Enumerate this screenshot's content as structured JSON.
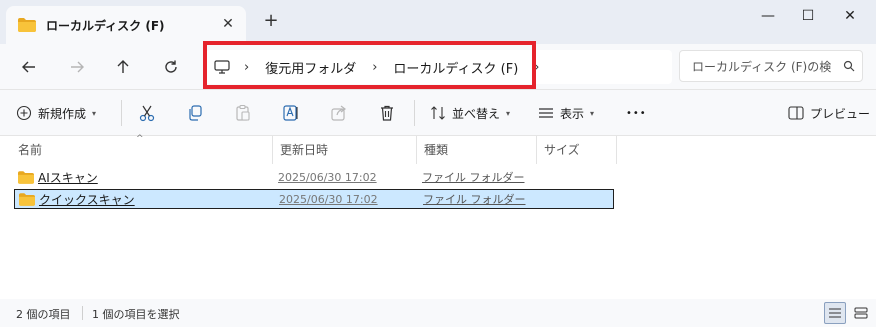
{
  "window": {
    "tab_title": "ローカルディスク (F)",
    "close_glyph": "✕",
    "new_tab_glyph": "+",
    "minimize_glyph": "—",
    "maximize_glyph": "☐",
    "close_window_glyph": "✕"
  },
  "breadcrumb": {
    "sep": "›",
    "items": [
      "復元用フォルダ",
      "ローカルディスク (F)"
    ]
  },
  "search": {
    "placeholder": "ローカルディスク (F)の検"
  },
  "toolbar": {
    "new_label": "新規作成",
    "sort_label": "並べ替え",
    "view_label": "表示",
    "more_glyph": "•••",
    "preview_label": "プレビュー",
    "caret": "▾"
  },
  "columns": [
    "名前",
    "更新日時",
    "種類",
    "サイズ"
  ],
  "sort_glyph": "^",
  "files": [
    {
      "name": "AIスキャン",
      "date": "2025/06/30 17:02",
      "type": "ファイル フォルダー"
    },
    {
      "name": "クイックスキャン",
      "date": "2025/06/30 17:02",
      "type": "ファイル フォルダー"
    }
  ],
  "status": {
    "count": "2 個の項目",
    "selected": "1 個の項目を選択"
  },
  "colors": {
    "folder": "#f8c33a",
    "folder_back": "#e8a821",
    "highlight": "#e5232c",
    "selection": "#cce8ff"
  }
}
